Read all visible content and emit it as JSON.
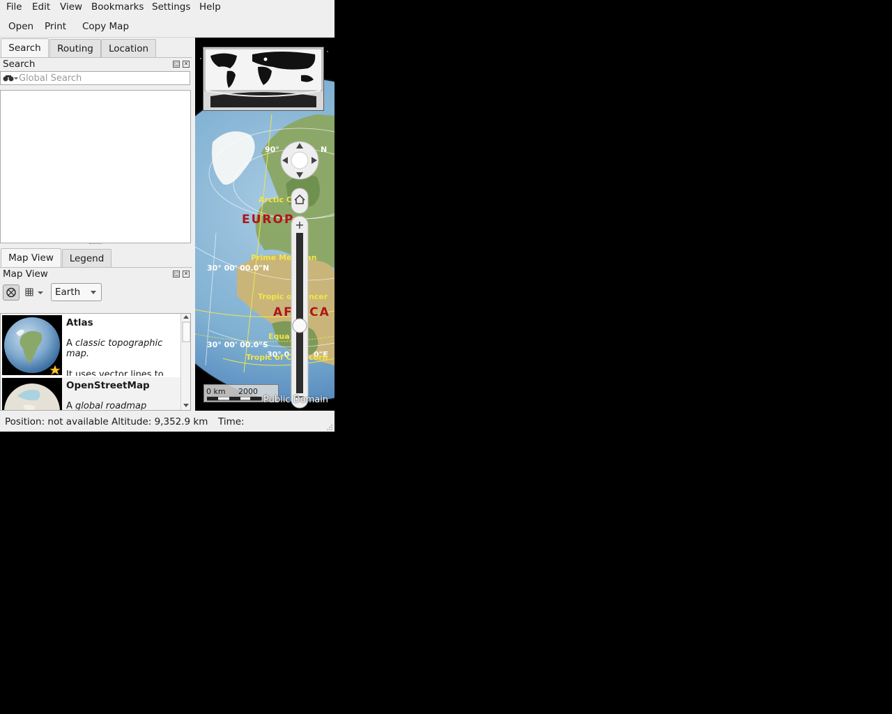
{
  "menu": [
    "File",
    "Edit",
    "View",
    "Bookmarks",
    "Settings",
    "Help"
  ],
  "toolbar": {
    "open": "Open",
    "print": "Print",
    "copy_map": "Copy Map"
  },
  "top_tabs": [
    "Search",
    "Routing",
    "Location"
  ],
  "search_panel": {
    "title": "Search",
    "placeholder": "Global Search"
  },
  "bottom_tabs": [
    "Map View",
    "Legend"
  ],
  "mapview_panel": {
    "title": "Map View",
    "planet": "Earth"
  },
  "maps": [
    {
      "name": "Atlas",
      "desc_prefix": "A ",
      "desc_em": "classic topographic map.",
      "desc_more": "It uses vector lines to"
    },
    {
      "name": "OpenStreetMap",
      "desc_prefix": "A ",
      "desc_em": "global roadmap"
    }
  ],
  "status": {
    "position": "Position: not available",
    "altitude": "Altitude:  9,352.9 km",
    "time": "Time:"
  },
  "map": {
    "lat_90": "90°",
    "lat_n": "N",
    "arctic": "Arctic C",
    "europe": "EUROP",
    "prime_meridian": "Prime Meridian",
    "lat_30n": "30° 00' 00.0\"N",
    "tropic_cancer": "Tropic of Cancer",
    "africa": "AFRICA",
    "equator": "Equa",
    "lat_30s": "30° 00' 00.0\"S",
    "lon_30e": "30° 0",
    "lon_30e_end": "0\"E",
    "tropic_capricorn": "Tropic of Capricorn",
    "scale_0": "0 km",
    "scale_2000": "2000",
    "attribution": "Public Domain"
  }
}
